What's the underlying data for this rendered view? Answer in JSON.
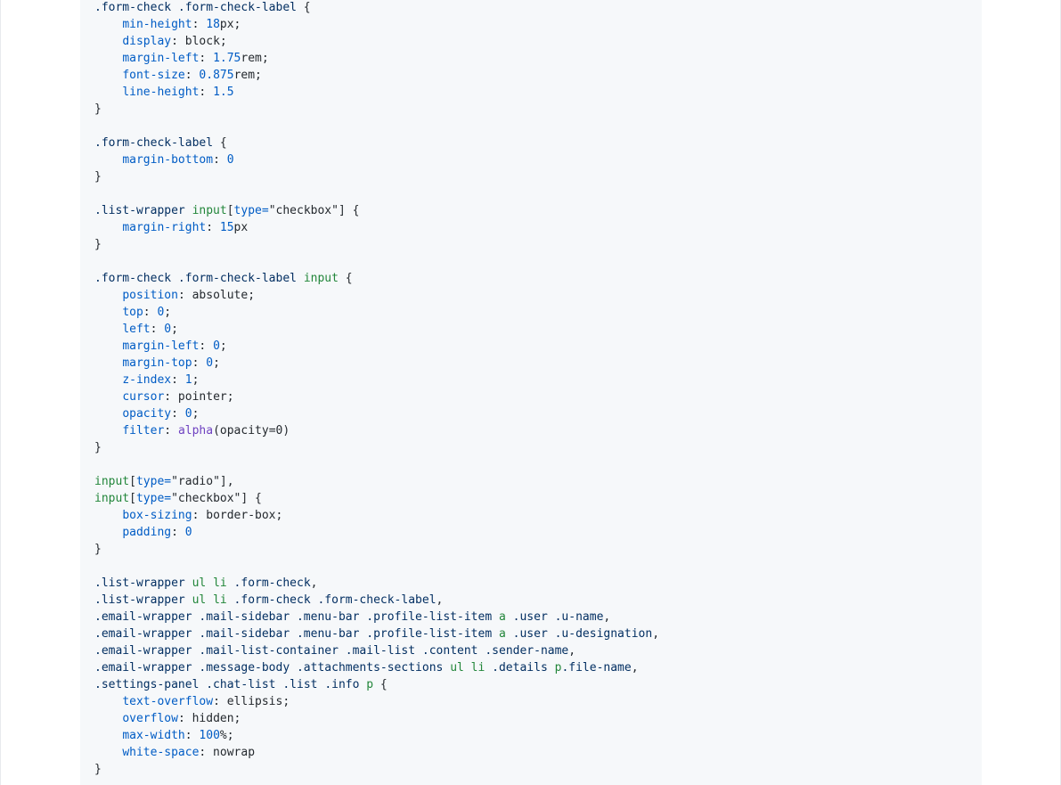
{
  "code": {
    "lines": [
      [
        {
          "t": ".form-check",
          "c": "selector"
        },
        {
          "t": " ",
          "c": "plain"
        },
        {
          "t": ".form-check-label",
          "c": "selector"
        },
        {
          "t": " {",
          "c": "plain"
        }
      ],
      [
        {
          "t": "    ",
          "c": "plain"
        },
        {
          "t": "min-height",
          "c": "prop"
        },
        {
          "t": ": ",
          "c": "plain"
        },
        {
          "t": "18",
          "c": "num"
        },
        {
          "t": "px;",
          "c": "plain"
        }
      ],
      [
        {
          "t": "    ",
          "c": "plain"
        },
        {
          "t": "display",
          "c": "prop"
        },
        {
          "t": ": block;",
          "c": "plain"
        }
      ],
      [
        {
          "t": "    ",
          "c": "plain"
        },
        {
          "t": "margin-left",
          "c": "prop"
        },
        {
          "t": ": ",
          "c": "plain"
        },
        {
          "t": "1.75",
          "c": "num"
        },
        {
          "t": "rem;",
          "c": "plain"
        }
      ],
      [
        {
          "t": "    ",
          "c": "plain"
        },
        {
          "t": "font-size",
          "c": "prop"
        },
        {
          "t": ": ",
          "c": "plain"
        },
        {
          "t": "0.875",
          "c": "num"
        },
        {
          "t": "rem;",
          "c": "plain"
        }
      ],
      [
        {
          "t": "    ",
          "c": "plain"
        },
        {
          "t": "line-height",
          "c": "prop"
        },
        {
          "t": ": ",
          "c": "plain"
        },
        {
          "t": "1.5",
          "c": "num"
        }
      ],
      [
        {
          "t": "}",
          "c": "plain"
        }
      ],
      [],
      [
        {
          "t": ".form-check-label",
          "c": "selector"
        },
        {
          "t": " {",
          "c": "plain"
        }
      ],
      [
        {
          "t": "    ",
          "c": "plain"
        },
        {
          "t": "margin-bottom",
          "c": "prop"
        },
        {
          "t": ": ",
          "c": "plain"
        },
        {
          "t": "0",
          "c": "num"
        }
      ],
      [
        {
          "t": "}",
          "c": "plain"
        }
      ],
      [],
      [
        {
          "t": ".list-wrapper",
          "c": "selector"
        },
        {
          "t": " ",
          "c": "plain"
        },
        {
          "t": "input",
          "c": "tag"
        },
        {
          "t": "[",
          "c": "plain"
        },
        {
          "t": "type=",
          "c": "attr"
        },
        {
          "t": "\"checkbox\"",
          "c": "plain"
        },
        {
          "t": "] {",
          "c": "plain"
        }
      ],
      [
        {
          "t": "    ",
          "c": "plain"
        },
        {
          "t": "margin-right",
          "c": "prop"
        },
        {
          "t": ": ",
          "c": "plain"
        },
        {
          "t": "15",
          "c": "num"
        },
        {
          "t": "px",
          "c": "plain"
        }
      ],
      [
        {
          "t": "}",
          "c": "plain"
        }
      ],
      [],
      [
        {
          "t": ".form-check",
          "c": "selector"
        },
        {
          "t": " ",
          "c": "plain"
        },
        {
          "t": ".form-check-label",
          "c": "selector"
        },
        {
          "t": " ",
          "c": "plain"
        },
        {
          "t": "input",
          "c": "tag"
        },
        {
          "t": " {",
          "c": "plain"
        }
      ],
      [
        {
          "t": "    ",
          "c": "plain"
        },
        {
          "t": "position",
          "c": "prop"
        },
        {
          "t": ": absolute;",
          "c": "plain"
        }
      ],
      [
        {
          "t": "    ",
          "c": "plain"
        },
        {
          "t": "top",
          "c": "prop"
        },
        {
          "t": ": ",
          "c": "plain"
        },
        {
          "t": "0",
          "c": "num"
        },
        {
          "t": ";",
          "c": "plain"
        }
      ],
      [
        {
          "t": "    ",
          "c": "plain"
        },
        {
          "t": "left",
          "c": "prop"
        },
        {
          "t": ": ",
          "c": "plain"
        },
        {
          "t": "0",
          "c": "num"
        },
        {
          "t": ";",
          "c": "plain"
        }
      ],
      [
        {
          "t": "    ",
          "c": "plain"
        },
        {
          "t": "margin-left",
          "c": "prop"
        },
        {
          "t": ": ",
          "c": "plain"
        },
        {
          "t": "0",
          "c": "num"
        },
        {
          "t": ";",
          "c": "plain"
        }
      ],
      [
        {
          "t": "    ",
          "c": "plain"
        },
        {
          "t": "margin-top",
          "c": "prop"
        },
        {
          "t": ": ",
          "c": "plain"
        },
        {
          "t": "0",
          "c": "num"
        },
        {
          "t": ";",
          "c": "plain"
        }
      ],
      [
        {
          "t": "    ",
          "c": "plain"
        },
        {
          "t": "z-index",
          "c": "prop"
        },
        {
          "t": ": ",
          "c": "plain"
        },
        {
          "t": "1",
          "c": "num"
        },
        {
          "t": ";",
          "c": "plain"
        }
      ],
      [
        {
          "t": "    ",
          "c": "plain"
        },
        {
          "t": "cursor",
          "c": "prop"
        },
        {
          "t": ": pointer;",
          "c": "plain"
        }
      ],
      [
        {
          "t": "    ",
          "c": "plain"
        },
        {
          "t": "opacity",
          "c": "prop"
        },
        {
          "t": ": ",
          "c": "plain"
        },
        {
          "t": "0",
          "c": "num"
        },
        {
          "t": ";",
          "c": "plain"
        }
      ],
      [
        {
          "t": "    ",
          "c": "plain"
        },
        {
          "t": "filter",
          "c": "prop"
        },
        {
          "t": ": ",
          "c": "plain"
        },
        {
          "t": "alpha",
          "c": "func"
        },
        {
          "t": "(opacity=0)",
          "c": "plain"
        }
      ],
      [
        {
          "t": "}",
          "c": "plain"
        }
      ],
      [],
      [
        {
          "t": "input",
          "c": "tag"
        },
        {
          "t": "[",
          "c": "plain"
        },
        {
          "t": "type=",
          "c": "attr"
        },
        {
          "t": "\"radio\"",
          "c": "plain"
        },
        {
          "t": "],",
          "c": "plain"
        }
      ],
      [
        {
          "t": "input",
          "c": "tag"
        },
        {
          "t": "[",
          "c": "plain"
        },
        {
          "t": "type=",
          "c": "attr"
        },
        {
          "t": "\"checkbox\"",
          "c": "plain"
        },
        {
          "t": "] {",
          "c": "plain"
        }
      ],
      [
        {
          "t": "    ",
          "c": "plain"
        },
        {
          "t": "box-sizing",
          "c": "prop"
        },
        {
          "t": ": border-box;",
          "c": "plain"
        }
      ],
      [
        {
          "t": "    ",
          "c": "plain"
        },
        {
          "t": "padding",
          "c": "prop"
        },
        {
          "t": ": ",
          "c": "plain"
        },
        {
          "t": "0",
          "c": "num"
        }
      ],
      [
        {
          "t": "}",
          "c": "plain"
        }
      ],
      [],
      [
        {
          "t": ".list-wrapper",
          "c": "selector"
        },
        {
          "t": " ",
          "c": "plain"
        },
        {
          "t": "ul",
          "c": "tag"
        },
        {
          "t": " ",
          "c": "plain"
        },
        {
          "t": "li",
          "c": "tag"
        },
        {
          "t": " ",
          "c": "plain"
        },
        {
          "t": ".form-check",
          "c": "selector"
        },
        {
          "t": ",",
          "c": "plain"
        }
      ],
      [
        {
          "t": ".list-wrapper",
          "c": "selector"
        },
        {
          "t": " ",
          "c": "plain"
        },
        {
          "t": "ul",
          "c": "tag"
        },
        {
          "t": " ",
          "c": "plain"
        },
        {
          "t": "li",
          "c": "tag"
        },
        {
          "t": " ",
          "c": "plain"
        },
        {
          "t": ".form-check",
          "c": "selector"
        },
        {
          "t": " ",
          "c": "plain"
        },
        {
          "t": ".form-check-label",
          "c": "selector"
        },
        {
          "t": ",",
          "c": "plain"
        }
      ],
      [
        {
          "t": ".email-wrapper",
          "c": "selector"
        },
        {
          "t": " ",
          "c": "plain"
        },
        {
          "t": ".mail-sidebar",
          "c": "selector"
        },
        {
          "t": " ",
          "c": "plain"
        },
        {
          "t": ".menu-bar",
          "c": "selector"
        },
        {
          "t": " ",
          "c": "plain"
        },
        {
          "t": ".profile-list-item",
          "c": "selector"
        },
        {
          "t": " ",
          "c": "plain"
        },
        {
          "t": "a",
          "c": "tag"
        },
        {
          "t": " ",
          "c": "plain"
        },
        {
          "t": ".user",
          "c": "selector"
        },
        {
          "t": " ",
          "c": "plain"
        },
        {
          "t": ".u-name",
          "c": "selector"
        },
        {
          "t": ",",
          "c": "plain"
        }
      ],
      [
        {
          "t": ".email-wrapper",
          "c": "selector"
        },
        {
          "t": " ",
          "c": "plain"
        },
        {
          "t": ".mail-sidebar",
          "c": "selector"
        },
        {
          "t": " ",
          "c": "plain"
        },
        {
          "t": ".menu-bar",
          "c": "selector"
        },
        {
          "t": " ",
          "c": "plain"
        },
        {
          "t": ".profile-list-item",
          "c": "selector"
        },
        {
          "t": " ",
          "c": "plain"
        },
        {
          "t": "a",
          "c": "tag"
        },
        {
          "t": " ",
          "c": "plain"
        },
        {
          "t": ".user",
          "c": "selector"
        },
        {
          "t": " ",
          "c": "plain"
        },
        {
          "t": ".u-designation",
          "c": "selector"
        },
        {
          "t": ",",
          "c": "plain"
        }
      ],
      [
        {
          "t": ".email-wrapper",
          "c": "selector"
        },
        {
          "t": " ",
          "c": "plain"
        },
        {
          "t": ".mail-list-container",
          "c": "selector"
        },
        {
          "t": " ",
          "c": "plain"
        },
        {
          "t": ".mail-list",
          "c": "selector"
        },
        {
          "t": " ",
          "c": "plain"
        },
        {
          "t": ".content",
          "c": "selector"
        },
        {
          "t": " ",
          "c": "plain"
        },
        {
          "t": ".sender-name",
          "c": "selector"
        },
        {
          "t": ",",
          "c": "plain"
        }
      ],
      [
        {
          "t": ".email-wrapper",
          "c": "selector"
        },
        {
          "t": " ",
          "c": "plain"
        },
        {
          "t": ".message-body",
          "c": "selector"
        },
        {
          "t": " ",
          "c": "plain"
        },
        {
          "t": ".attachments-sections",
          "c": "selector"
        },
        {
          "t": " ",
          "c": "plain"
        },
        {
          "t": "ul",
          "c": "tag"
        },
        {
          "t": " ",
          "c": "plain"
        },
        {
          "t": "li",
          "c": "tag"
        },
        {
          "t": " ",
          "c": "plain"
        },
        {
          "t": ".details",
          "c": "selector"
        },
        {
          "t": " ",
          "c": "plain"
        },
        {
          "t": "p",
          "c": "tag"
        },
        {
          "t": ".file-name",
          "c": "selector"
        },
        {
          "t": ",",
          "c": "plain"
        }
      ],
      [
        {
          "t": ".settings-panel",
          "c": "selector"
        },
        {
          "t": " ",
          "c": "plain"
        },
        {
          "t": ".chat-list",
          "c": "selector"
        },
        {
          "t": " ",
          "c": "plain"
        },
        {
          "t": ".list",
          "c": "selector"
        },
        {
          "t": " ",
          "c": "plain"
        },
        {
          "t": ".info",
          "c": "selector"
        },
        {
          "t": " ",
          "c": "plain"
        },
        {
          "t": "p",
          "c": "tag"
        },
        {
          "t": " {",
          "c": "plain"
        }
      ],
      [
        {
          "t": "    ",
          "c": "plain"
        },
        {
          "t": "text-overflow",
          "c": "prop"
        },
        {
          "t": ": ellipsis;",
          "c": "plain"
        }
      ],
      [
        {
          "t": "    ",
          "c": "plain"
        },
        {
          "t": "overflow",
          "c": "prop"
        },
        {
          "t": ": hidden;",
          "c": "plain"
        }
      ],
      [
        {
          "t": "    ",
          "c": "plain"
        },
        {
          "t": "max-width",
          "c": "prop"
        },
        {
          "t": ": ",
          "c": "plain"
        },
        {
          "t": "100",
          "c": "num"
        },
        {
          "t": "%;",
          "c": "plain"
        }
      ],
      [
        {
          "t": "    ",
          "c": "plain"
        },
        {
          "t": "white-space",
          "c": "prop"
        },
        {
          "t": ": nowrap",
          "c": "plain"
        }
      ],
      [
        {
          "t": "}",
          "c": "plain"
        }
      ]
    ]
  }
}
